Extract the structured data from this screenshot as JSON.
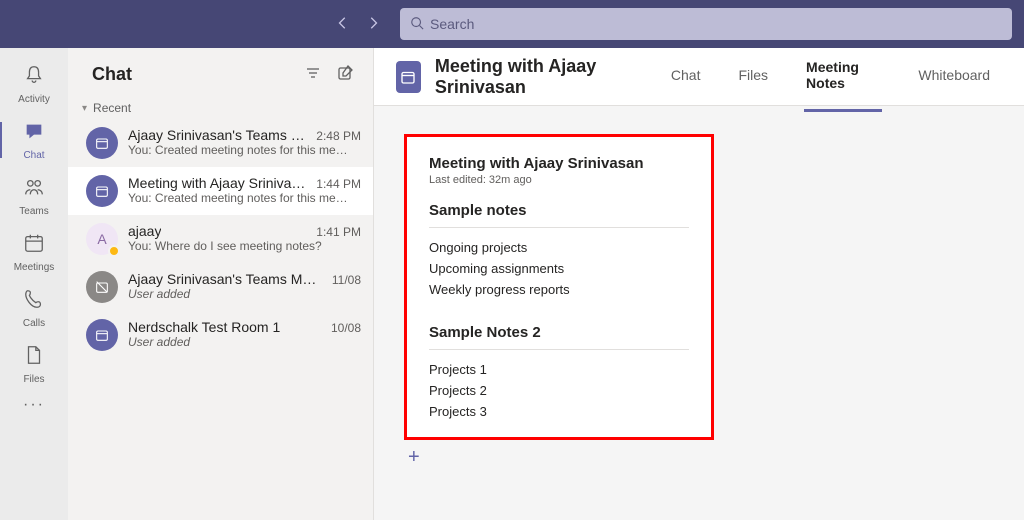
{
  "search": {
    "placeholder": "Search"
  },
  "rail": {
    "items": [
      {
        "label": "Activity"
      },
      {
        "label": "Chat"
      },
      {
        "label": "Teams"
      },
      {
        "label": "Meetings"
      },
      {
        "label": "Calls"
      },
      {
        "label": "Files"
      }
    ]
  },
  "sidebar": {
    "title": "Chat",
    "section": "Recent",
    "items": [
      {
        "name": "Ajaay Srinivasan's Teams Mee…",
        "time": "2:48 PM",
        "preview": "You: Created meeting notes for this me…"
      },
      {
        "name": "Meeting with Ajaay Srinivasan",
        "time": "1:44 PM",
        "preview": "You: Created meeting notes for this me…"
      },
      {
        "name": "ajaay",
        "time": "1:41 PM",
        "preview": "You: Where do I see meeting notes?"
      },
      {
        "name": "Ajaay Srinivasan's Teams Meeting",
        "time": "11/08",
        "preview": "User added"
      },
      {
        "name": "Nerdschalk Test Room 1",
        "time": "10/08",
        "preview": "User added"
      }
    ]
  },
  "header": {
    "title": "Meeting with Ajaay Srinivasan",
    "tabs": [
      {
        "label": "Chat"
      },
      {
        "label": "Files"
      },
      {
        "label": "Meeting Notes"
      },
      {
        "label": "Whiteboard"
      }
    ]
  },
  "notes": {
    "title": "Meeting with Ajaay Srinivasan",
    "edited": "Last edited: 32m ago",
    "section1": {
      "heading": "Sample notes",
      "lines": [
        "Ongoing projects",
        "Upcoming assignments",
        "Weekly progress reports"
      ]
    },
    "section2": {
      "heading": "Sample Notes 2",
      "lines": [
        "Projects 1",
        "Projects 2",
        "Projects 3"
      ]
    }
  }
}
